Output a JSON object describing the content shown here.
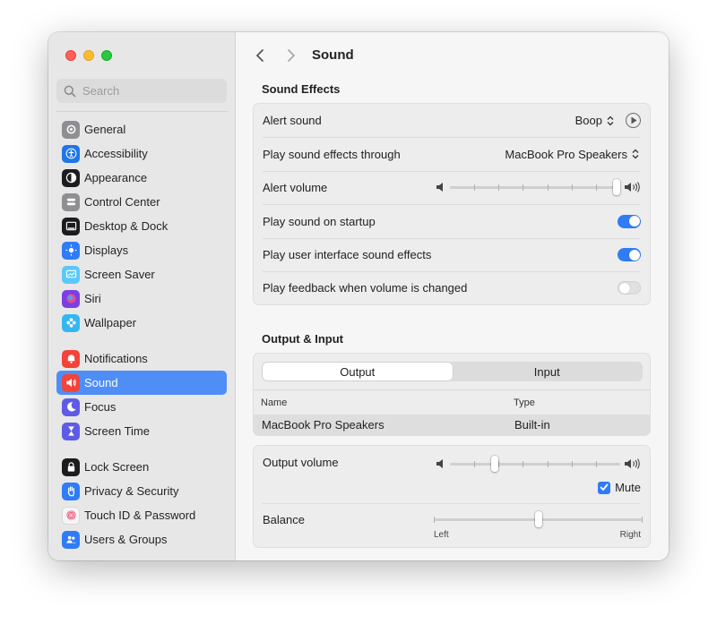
{
  "window": {
    "title": "Sound"
  },
  "sidebar": {
    "search_placeholder": "Search",
    "groups": [
      [
        {
          "label": "General",
          "icon": "gear-icon",
          "color": "#8e8e93"
        },
        {
          "label": "Accessibility",
          "icon": "accessibility-icon",
          "color": "#1f76e6"
        },
        {
          "label": "Appearance",
          "icon": "appearance-icon",
          "color": "#1c1c1e"
        },
        {
          "label": "Control Center",
          "icon": "control-center-icon",
          "color": "#8e8e93"
        },
        {
          "label": "Desktop & Dock",
          "icon": "dock-icon",
          "color": "#1c1c1e"
        },
        {
          "label": "Displays",
          "icon": "sun-icon",
          "color": "#2f7cf6"
        },
        {
          "label": "Screen Saver",
          "icon": "screen-saver-icon",
          "color": "#5ac8fa"
        },
        {
          "label": "Siri",
          "icon": "siri-icon",
          "color": "#7b3fe4"
        },
        {
          "label": "Wallpaper",
          "icon": "flower-icon",
          "color": "#34b7f1"
        }
      ],
      [
        {
          "label": "Notifications",
          "icon": "bell-icon",
          "color": "#f2443a"
        },
        {
          "label": "Sound",
          "icon": "speaker-icon",
          "color": "#f2443a",
          "active": true
        },
        {
          "label": "Focus",
          "icon": "moon-icon",
          "color": "#5e5ce6"
        },
        {
          "label": "Screen Time",
          "icon": "hourglass-icon",
          "color": "#5e5ce6"
        }
      ],
      [
        {
          "label": "Lock Screen",
          "icon": "lock-icon",
          "color": "#1c1c1e"
        },
        {
          "label": "Privacy & Security",
          "icon": "hand-icon",
          "color": "#2f7cf6"
        },
        {
          "label": "Touch ID & Password",
          "icon": "fingerprint-icon",
          "color": "#f5f5f5"
        },
        {
          "label": "Users & Groups",
          "icon": "users-icon",
          "color": "#2f7cf6"
        }
      ]
    ]
  },
  "main": {
    "title": "Sound",
    "sound_effects": {
      "heading": "Sound Effects",
      "alert_sound": {
        "label": "Alert sound",
        "value": "Boop"
      },
      "play_through": {
        "label": "Play sound effects through",
        "value": "MacBook Pro Speakers"
      },
      "alert_volume": {
        "label": "Alert volume",
        "level": 1.0
      },
      "startup": {
        "label": "Play sound on startup",
        "on": true
      },
      "ui_effects": {
        "label": "Play user interface sound effects",
        "on": true
      },
      "feedback": {
        "label": "Play feedback when volume is changed",
        "on": false
      }
    },
    "output_input": {
      "heading": "Output & Input",
      "tabs": [
        "Output",
        "Input"
      ],
      "selected_tab": "Output",
      "columns": [
        "Name",
        "Type"
      ],
      "devices": [
        {
          "name": "MacBook Pro Speakers",
          "type": "Built-in"
        }
      ]
    },
    "output": {
      "volume_label": "Output volume",
      "volume_level": 0.25,
      "mute_label": "Mute",
      "muted": true,
      "balance_label": "Balance",
      "balance_level": 0.5,
      "balance_left": "Left",
      "balance_right": "Right"
    }
  },
  "colors": {
    "accent": "#2f7cf6",
    "sidebar_selection": "#4f8ef7"
  }
}
